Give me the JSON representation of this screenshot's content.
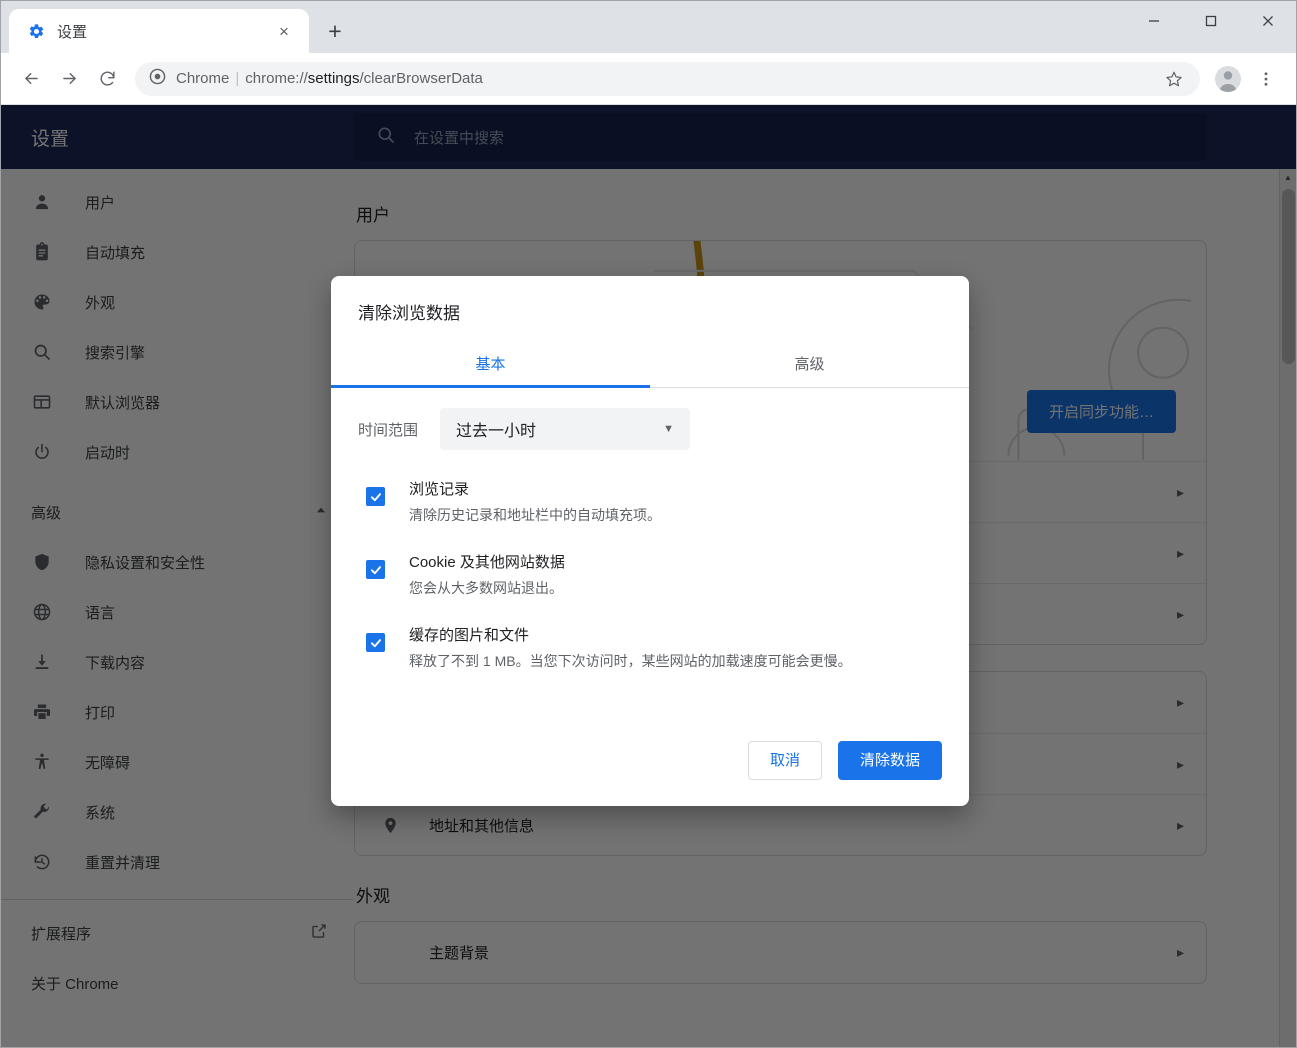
{
  "browser": {
    "tab": {
      "title": "设置",
      "favicon": "gear-icon",
      "close": "×"
    },
    "new_tab": "+",
    "window_controls": {
      "minimize": "—",
      "maximize": "□",
      "close": "✕"
    },
    "toolbar": {
      "back": "←",
      "forward": "→",
      "reload": "⟳",
      "scheme_label": "Chrome",
      "separator": "|",
      "url_prefix": "chrome://",
      "url_bold": "settings",
      "url_suffix": "/clearBrowserData",
      "bookmark": "☆",
      "profile": "avatar",
      "menu": "⋮"
    }
  },
  "settings": {
    "title": "设置",
    "search_placeholder": "在设置中搜索",
    "search_icon": "search-icon",
    "sidebar": {
      "items": [
        {
          "label": "用户",
          "icon": "person-icon"
        },
        {
          "label": "自动填充",
          "icon": "clipboard-icon"
        },
        {
          "label": "外观",
          "icon": "palette-icon"
        },
        {
          "label": "搜索引擎",
          "icon": "search-icon"
        },
        {
          "label": "默认浏览器",
          "icon": "browser-window-icon"
        },
        {
          "label": "启动时",
          "icon": "power-icon"
        }
      ],
      "advanced_group": {
        "label": "高级",
        "caret": "▲"
      },
      "advanced_items": [
        {
          "label": "隐私设置和安全性",
          "icon": "shield-icon"
        },
        {
          "label": "语言",
          "icon": "globe-icon"
        },
        {
          "label": "下载内容",
          "icon": "download-icon"
        },
        {
          "label": "打印",
          "icon": "printer-icon"
        },
        {
          "label": "无障碍",
          "icon": "accessibility-icon"
        },
        {
          "label": "系统",
          "icon": "wrench-icon"
        },
        {
          "label": "重置并清理",
          "icon": "history-restore-icon"
        }
      ],
      "footer_items": [
        {
          "label": "扩展程序",
          "icon": "open-in-new-icon"
        },
        {
          "label": "关于 Chrome",
          "icon": ""
        }
      ]
    },
    "content": {
      "user_section_title": "用户",
      "sync_button": "开启同步功能…",
      "address_row": {
        "label": "地址和其他信息",
        "icon": "location-pin-icon",
        "chevron": "▸"
      },
      "appearance_section_title": "外观",
      "theme_row_label": "主题背景",
      "chevron": "▸"
    },
    "scrollbar": {
      "up_arrow": "▲"
    }
  },
  "dialog": {
    "title": "清除浏览数据",
    "tabs": [
      {
        "label": "基本",
        "active": true
      },
      {
        "label": "高级",
        "active": false
      }
    ],
    "time_range": {
      "label": "时间范围",
      "value": "过去一小时",
      "caret": "▼"
    },
    "checkmark": "✓",
    "options": [
      {
        "title": "浏览记录",
        "desc": "清除历史记录和地址栏中的自动填充项。",
        "checked": true
      },
      {
        "title": "Cookie 及其他网站数据",
        "desc": "您会从大多数网站退出。",
        "checked": true
      },
      {
        "title": "缓存的图片和文件",
        "desc": "释放了不到 1 MB。当您下次访问时，某些网站的加载速度可能会更慢。",
        "checked": true
      }
    ],
    "buttons": {
      "cancel": "取消",
      "confirm": "清除数据"
    }
  },
  "colors": {
    "accent": "#1a73e8",
    "header_bg": "#1b2a5a",
    "tabstrip_bg": "#dee1e6"
  }
}
